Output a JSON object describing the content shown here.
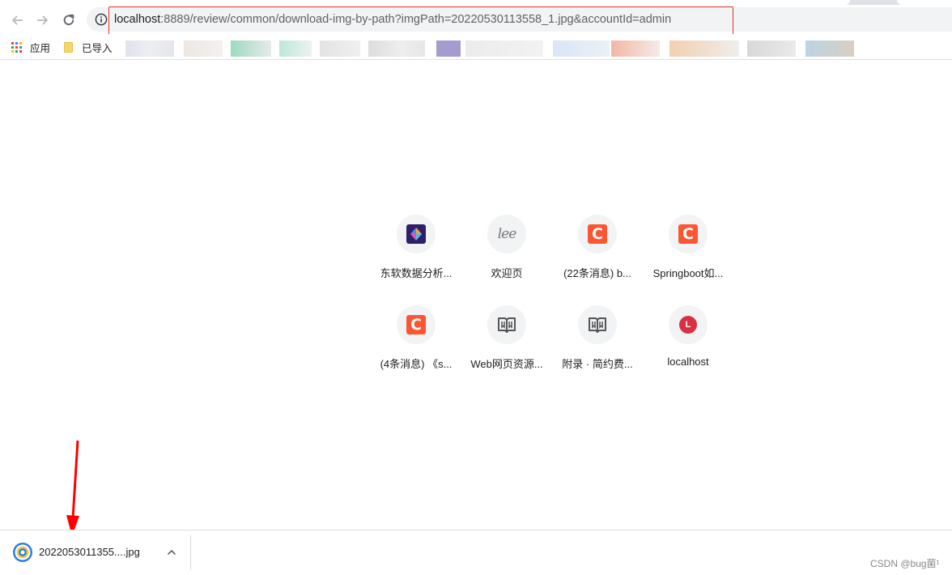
{
  "browser": {
    "url_host": "localhost",
    "url_rest": ":8889/review/common/download-img-by-path?imgPath=20220530113558_1.jpg&accountId=admin"
  },
  "bookmarks": {
    "apps_label": "应用",
    "imported_label": "已导入"
  },
  "tiles": [
    {
      "label": "东软数据分析...",
      "icon": "diamond-logo-icon"
    },
    {
      "label": "欢迎页",
      "icon": "lee-logo-icon"
    },
    {
      "label": "(22条消息) b...",
      "icon": "csdn-c-icon"
    },
    {
      "label": "Springboot如...",
      "icon": "csdn-c-icon"
    },
    {
      "label": "(4条消息) 《s...",
      "icon": "csdn-c-icon"
    },
    {
      "label": "Web网页资源...",
      "icon": "book-icon"
    },
    {
      "label": "附录 · 简约费...",
      "icon": "book-icon"
    },
    {
      "label": "localhost",
      "icon": "letter-l-icon"
    }
  ],
  "tile_glyphs": {
    "csdn": "C",
    "lee": "lee",
    "localhost": "L"
  },
  "download": {
    "filename": "2022053011355....jpg"
  },
  "watermark": "CSDN @bug菌¹",
  "colors": {
    "highlight_box": "#d9342b",
    "arrow": "#ff0000",
    "csdn_orange": "#fc5531",
    "localhost_red": "#d93044"
  }
}
